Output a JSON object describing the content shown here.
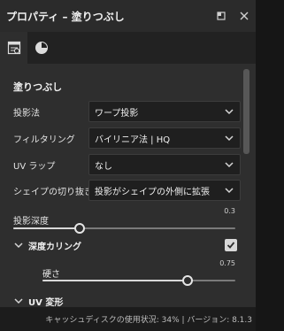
{
  "window": {
    "title": "プロパティ – 塗りつぶし"
  },
  "tabs": [
    {
      "icon": "properties-panel-icon",
      "active": true
    },
    {
      "icon": "material-sphere-icon",
      "active": false
    }
  ],
  "section": {
    "title": "塗りつぶし"
  },
  "fields": {
    "projection": {
      "label": "投影法",
      "value": "ワープ投影"
    },
    "filtering": {
      "label": "フィルタリング",
      "value": "バイリニア法 | HQ"
    },
    "uv_wrap": {
      "label": "UV ラップ",
      "value": "なし"
    },
    "shape_crop": {
      "label": "シェイプの切り抜き",
      "value": "投影がシェイプの外側に拡張"
    }
  },
  "projection_depth": {
    "label": "投影深度",
    "value": "0.3",
    "fraction": 0.3
  },
  "depth_culling": {
    "label": "深度カリング",
    "checked": true
  },
  "hardness": {
    "label": "硬さ",
    "value": "0.75",
    "fraction": 0.75
  },
  "uv_transform": {
    "label": "UV 変形"
  },
  "status": {
    "text": "キャッシュディスクの使用状況:  34% | バージョン: 8.1.3"
  },
  "colors": {
    "panel_bg": "#2e2e2e",
    "title_bg": "#2b2b2b",
    "field_bg": "#1f1f1f",
    "text": "#e6e6e6"
  }
}
